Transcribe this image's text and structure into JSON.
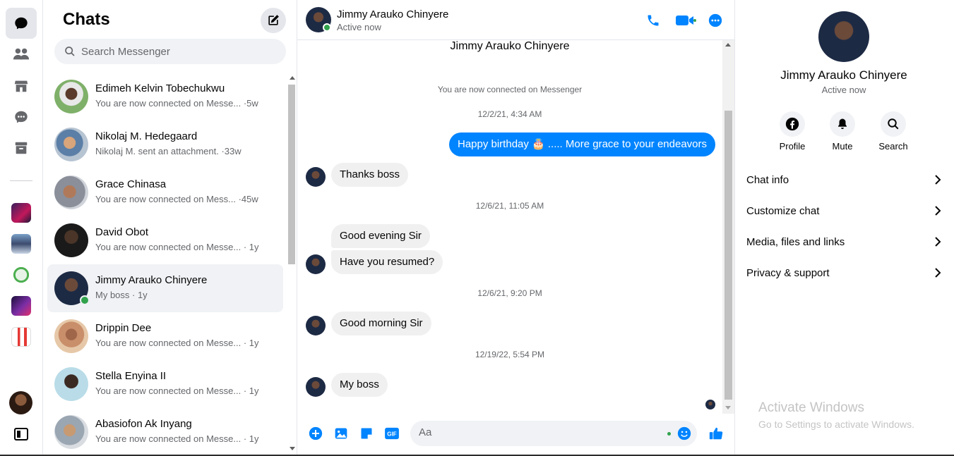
{
  "colors": {
    "accent": "#0084ff",
    "online": "#31a24c",
    "bubble_in": "#f0f0f0"
  },
  "rail": {
    "items": [
      {
        "icon": "chat-bubble-icon",
        "active": true
      },
      {
        "icon": "people-icon"
      },
      {
        "icon": "marketplace-icon"
      },
      {
        "icon": "message-requests-icon"
      },
      {
        "icon": "archive-icon"
      }
    ],
    "communities": [
      "community-1",
      "community-2",
      "community-3",
      "community-4",
      "community-5"
    ],
    "bottom": {
      "icon": "sidebar-toggle-icon"
    }
  },
  "list": {
    "title": "Chats",
    "search_placeholder": "Search Messenger",
    "chats": [
      {
        "name": "Edimeh Kelvin Tobechukwu",
        "preview": "You are now connected on Messe... ·5w"
      },
      {
        "name": "Nikolaj M. Hedegaard",
        "preview": "Nikolaj M. sent an attachment. ·33w"
      },
      {
        "name": "Grace Chinasa",
        "preview": "You are now connected on Mess... ·45w"
      },
      {
        "name": "David Obot",
        "preview": "You are now connected on Messe... · 1y"
      },
      {
        "name": "Jimmy Arauko Chinyere",
        "preview": "My boss · 1y",
        "selected": true,
        "online": true
      },
      {
        "name": "Drippin Dee",
        "preview": "You are now connected on Messe... · 1y"
      },
      {
        "name": "Stella Enyina II",
        "preview": "You are now connected on Messe... · 1y"
      },
      {
        "name": "Abasiofon Ak Inyang",
        "preview": "You are now connected on Messe... · 1y"
      }
    ]
  },
  "conversation": {
    "header": {
      "name": "Jimmy Arauko Chinyere",
      "status": "Active now"
    },
    "top_name": "Jimmy Arauko Chinyere",
    "connected_notice": "You are now connected on Messenger",
    "timestamps": [
      "12/2/21, 4:34 AM",
      "12/6/21, 11:05 AM",
      "12/6/21, 9:20 PM",
      "12/19/22, 5:54 PM"
    ],
    "messages": {
      "out_1": "Happy birthday 🎂 ..... More grace to your endeavors",
      "in_1": "Thanks boss",
      "in_2": "Good evening Sir",
      "in_3": "Have you resumed?",
      "in_4": "Good morning Sir",
      "in_5": "My boss"
    },
    "composer_placeholder": "Aa"
  },
  "info": {
    "name": "Jimmy Arauko Chinyere",
    "status": "Active now",
    "actions": [
      {
        "label": "Profile",
        "icon": "facebook-icon"
      },
      {
        "label": "Mute",
        "icon": "bell-icon"
      },
      {
        "label": "Search",
        "icon": "search-icon"
      }
    ],
    "menu": [
      "Chat info",
      "Customize chat",
      "Media, files and links",
      "Privacy & support"
    ],
    "watermark_title": "Activate Windows",
    "watermark_sub": "Go to Settings to activate Windows."
  }
}
